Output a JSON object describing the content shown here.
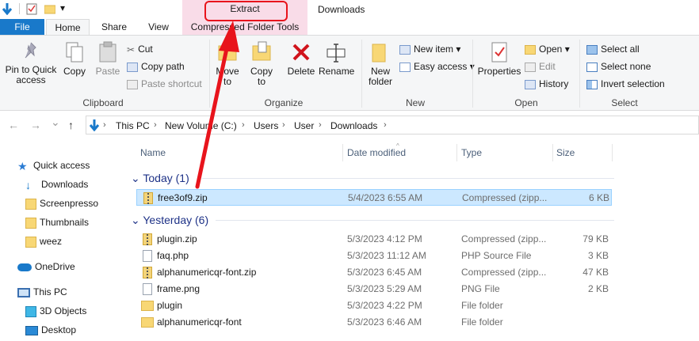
{
  "window": {
    "title": "Downloads"
  },
  "qat": {
    "dropdown_glyph": "▾"
  },
  "context": {
    "label": "Extract"
  },
  "tabs": {
    "file": "File",
    "home": "Home",
    "share": "Share",
    "view": "View",
    "compressed": "Compressed Folder Tools"
  },
  "clipboard": {
    "group": "Clipboard",
    "pin": "Pin to Quick access",
    "copy": "Copy",
    "paste": "Paste",
    "cut": "Cut",
    "copy_path": "Copy path",
    "paste_shortcut": "Paste shortcut"
  },
  "organize": {
    "group": "Organize",
    "move_to": "Move to",
    "copy_to": "Copy to",
    "delete": "Delete",
    "rename": "Rename"
  },
  "new": {
    "group": "New",
    "new_folder": "New folder",
    "new_item": "New item",
    "easy_access": "Easy access"
  },
  "open": {
    "group": "Open",
    "properties": "Properties",
    "open": "Open",
    "edit": "Edit",
    "history": "History"
  },
  "select": {
    "group": "Select",
    "select_all": "Select all",
    "select_none": "Select none",
    "invert_selection": "Invert selection"
  },
  "address": {
    "back": "←",
    "forward": "→",
    "recent": "⌄",
    "up": "↑",
    "crumbs": [
      "This PC",
      "New Volume (C:)",
      "Users",
      "User",
      "Downloads"
    ]
  },
  "columns": {
    "name": "Name",
    "date_modified": "Date modified",
    "type": "Type",
    "size": "Size"
  },
  "sidebar": {
    "items": [
      "Quick access",
      "Downloads",
      "Screenpresso",
      "Thumbnails",
      "weez",
      "OneDrive",
      "This PC",
      "3D Objects",
      "Desktop"
    ]
  },
  "groups": {
    "today": "Today (1)",
    "yesterday": "Yesterday (6)"
  },
  "files_today": [
    {
      "name": "free3of9.zip",
      "date": "5/4/2023 6:55 AM",
      "type": "Compressed (zipp...",
      "size": "6 KB",
      "icon": "zip"
    }
  ],
  "files_yesterday": [
    {
      "name": "plugin.zip",
      "date": "5/3/2023 4:12 PM",
      "type": "Compressed (zipp...",
      "size": "79 KB",
      "icon": "zip"
    },
    {
      "name": "faq.php",
      "date": "5/3/2023 11:12 AM",
      "type": "PHP Source File",
      "size": "3 KB",
      "icon": "php"
    },
    {
      "name": "alphanumericqr-font.zip",
      "date": "5/3/2023 6:45 AM",
      "type": "Compressed (zipp...",
      "size": "47 KB",
      "icon": "zip"
    },
    {
      "name": "frame.png",
      "date": "5/3/2023 5:29 AM",
      "type": "PNG File",
      "size": "2 KB",
      "icon": "png"
    },
    {
      "name": "plugin",
      "date": "5/3/2023 4:22 PM",
      "type": "File folder",
      "size": "",
      "icon": "folder"
    },
    {
      "name": "alphanumericqr-font",
      "date": "5/3/2023 6:46 AM",
      "type": "File folder",
      "size": "",
      "icon": "folder"
    }
  ],
  "colors": {
    "accent": "#1979ca",
    "context_tab": "#f9dce8",
    "selection": "#cce8ff",
    "annotation_red": "#e8141c"
  }
}
